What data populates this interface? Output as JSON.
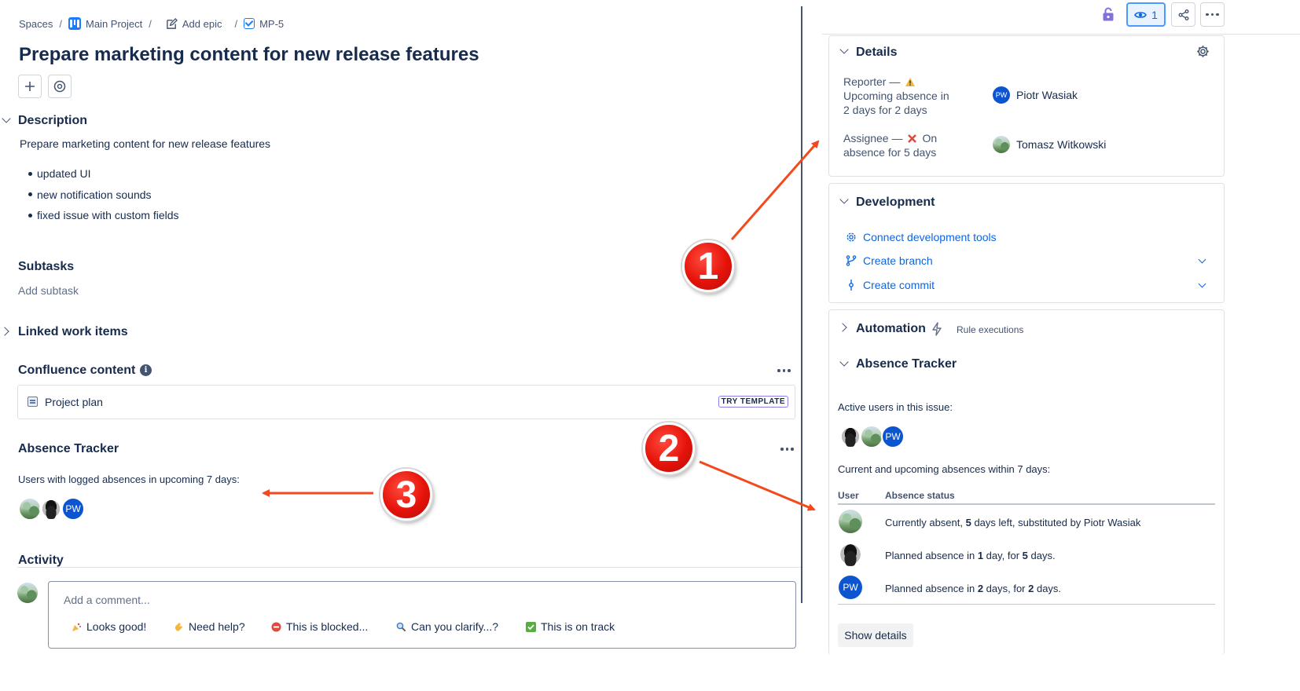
{
  "breadcrumb": {
    "spaces": "Spaces",
    "project": "Main Project",
    "epic": "Add epic",
    "key": "MP-5"
  },
  "issue": {
    "title": "Prepare marketing content for new release features"
  },
  "description": {
    "heading": "Description",
    "text": "Prepare marketing content for new release features",
    "bullets": [
      "updated UI",
      "new notification sounds",
      "fixed issue with custom fields"
    ]
  },
  "subtasks": {
    "heading": "Subtasks",
    "add": "Add subtask"
  },
  "linked": {
    "heading": "Linked work items"
  },
  "confluence": {
    "heading": "Confluence content",
    "page": "Project plan",
    "tag": "TRY TEMPLATE"
  },
  "absence_left": {
    "heading": "Absence Tracker",
    "text": "Users with logged absences in upcoming 7 days:",
    "pw_initials": "PW"
  },
  "activity": {
    "heading": "Activity",
    "placeholder": "Add a comment...",
    "quick": [
      "Looks good!",
      "Need help?",
      "This is blocked...",
      "Can you clarify...?",
      "This is on track"
    ]
  },
  "header": {
    "watch_count": "1"
  },
  "details": {
    "heading": "Details",
    "reporter_label_1": "Reporter —",
    "reporter_label_2": "Upcoming absence in",
    "reporter_label_3": "2 days for 2 days",
    "reporter_name": "Piotr Wasiak",
    "reporter_initials": "PW",
    "assignee_label_1": "Assignee —",
    "assignee_label_1b": "On",
    "assignee_label_2": "absence for 5 days",
    "assignee_name": "Tomasz Witkowski"
  },
  "development": {
    "heading": "Development",
    "connect": "Connect development tools",
    "branch": "Create branch",
    "commit": "Create commit"
  },
  "automation": {
    "heading": "Automation",
    "sub": "Rule executions"
  },
  "absence_right": {
    "heading": "Absence Tracker",
    "active_label": "Active users in this issue:",
    "upcoming_label": "Current and upcoming absences within 7 days:",
    "col_user": "User",
    "col_status": "Absence status",
    "pw_initials": "PW",
    "rows": [
      {
        "a": "Currently absent, ",
        "b": "5",
        "c": " days left, substituted by Piotr Wasiak",
        "d": "",
        "e": ""
      },
      {
        "a": "Planned absence in ",
        "b": "1",
        "c": " day, for ",
        "d": "5",
        "e": " days."
      },
      {
        "a": "Planned absence in ",
        "b": "2",
        "c": " days, for ",
        "d": "2",
        "e": " days."
      }
    ],
    "show_details": "Show details"
  },
  "callouts": [
    "1",
    "2",
    "3"
  ],
  "colors": {
    "accent": "#0c66e4",
    "callout": "#e5130a",
    "arrow": "#f24a1d"
  }
}
